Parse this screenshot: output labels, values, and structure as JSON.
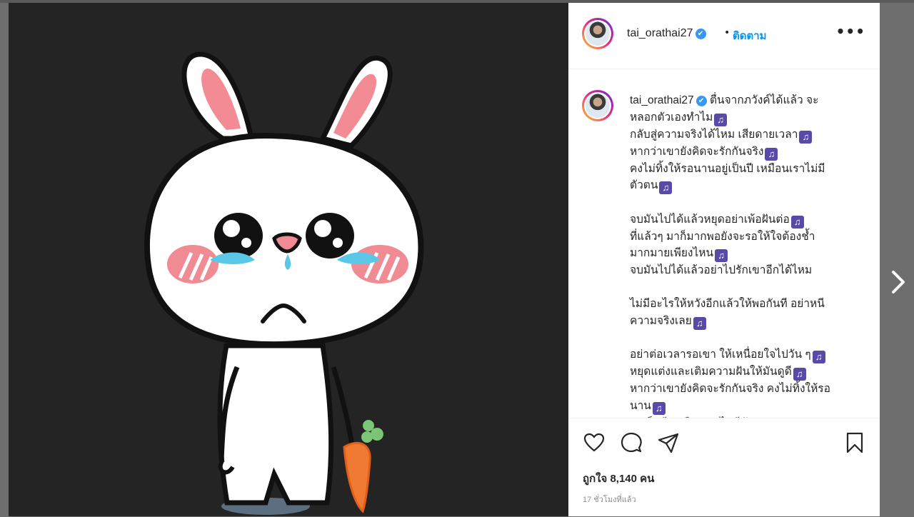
{
  "post": {
    "username": "tai_orathai27",
    "follow_label": "ติดตาม",
    "follow_separator": "•",
    "more_label": "•••",
    "verified_mark": "✔",
    "caption_lines": [
      "ตื่นจากภวังค์ได้แล้ว จะ",
      "หลอกตัวเองทำไม",
      "กลับสู่ความจริงได้ไหม เสียดายเวลา",
      "หากว่าเขายังคิดจะรักกันจริง",
      "คงไม่ทิ้งให้รอนานอยู่เป็นปี เหมือนเราไม่มี",
      "ตัวตน",
      "",
      "จบมันไปได้แล้วหยุดอย่าเพ้อฝันต่อ",
      "ที่แล้วๆ มาก็มากพอยังจะรอให้ใจต้องช้ำ",
      "มากมายเพียงไหน",
      "จบมันไปได้แล้วอย่าไปรักเขาอีกได้ไหม",
      "",
      "ไม่มีอะไรให้หวังอีกแล้วให้พอกันที อย่าหนี",
      "ความจริงเลย",
      "",
      "อย่าต่อเวลารอเขา ให้เหนื่อยใจไปวัน ๆ",
      "หยุดแต่งและเติมความฝันให้มันดูดี",
      "หากว่าเขายังคิดจะรักกันจริง คงไม่ทิ้งให้รอ",
      "นาน",
      "อยู่เป็นปี เหมือนเราไม่มีตัวตน"
    ],
    "music_emoji": "♫",
    "music_after": [
      false,
      true,
      true,
      true,
      false,
      true,
      false,
      true,
      false,
      true,
      false,
      true,
      false,
      true,
      false,
      true,
      true,
      false,
      true,
      true
    ],
    "likes_text": "ถูกใจ 8,140 คน",
    "time_text": "17 ชั่วโมงที่แล้ว"
  },
  "icons": {
    "like": "heart-icon",
    "comment": "comment-icon",
    "share": "share-icon",
    "save": "bookmark-icon",
    "next": "chevron-right-icon"
  },
  "colors": {
    "link": "#0095f6",
    "verified": "#3897f0",
    "image_bg": "#242424"
  }
}
